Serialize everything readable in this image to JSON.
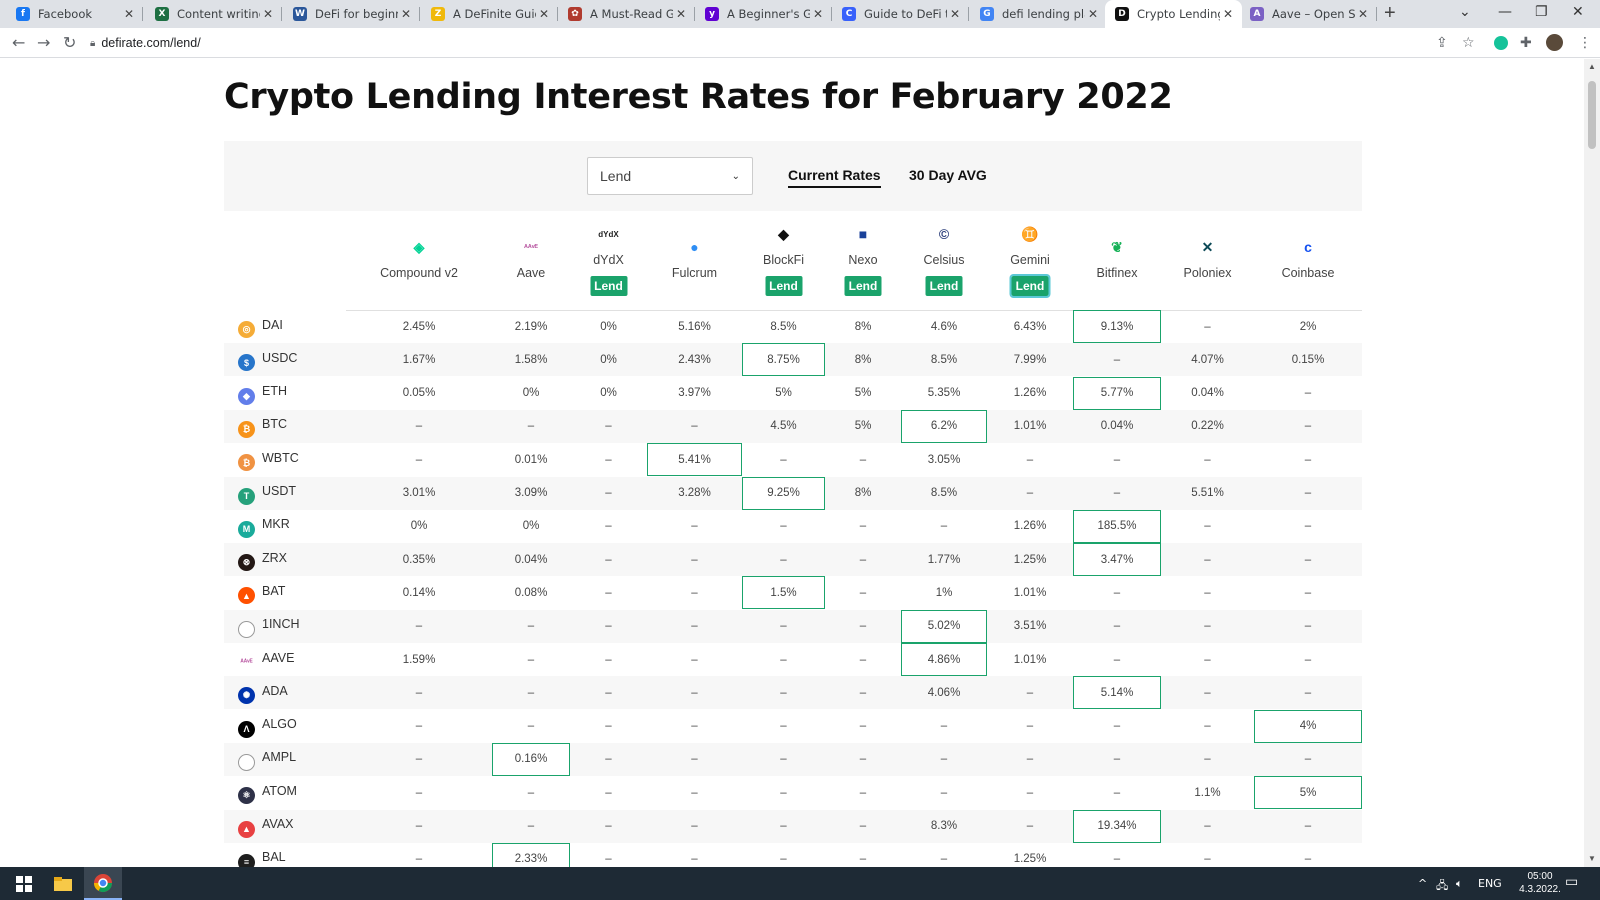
{
  "browser": {
    "tabs": [
      {
        "title": "Facebook",
        "icon": "facebook-icon",
        "color": "#1877f2",
        "glyph": "f"
      },
      {
        "title": "Content writing wi",
        "icon": "excel-icon",
        "color": "#1d6f42",
        "glyph": "X"
      },
      {
        "title": "DeFi for beginners",
        "icon": "word-icon",
        "color": "#2b579a",
        "glyph": "W"
      },
      {
        "title": "A DeFinite Guide t",
        "icon": "binance-icon",
        "color": "#f0b90b",
        "glyph": "Z"
      },
      {
        "title": "A Must-Read Guid",
        "icon": "community-icon",
        "color": "#b03a2e",
        "glyph": "✿"
      },
      {
        "title": "A Beginner's Guide",
        "icon": "yahoo-icon",
        "color": "#6001d2",
        "glyph": "y"
      },
      {
        "title": "Guide to DeFi toke",
        "icon": "coinmarketcap-icon",
        "color": "#3861fb",
        "glyph": "C"
      },
      {
        "title": "defi lending platfo",
        "icon": "google-icon",
        "color": "#4285f4",
        "glyph": "G"
      },
      {
        "title": "Crypto Lending Ra",
        "icon": "defirate-icon",
        "color": "#111111",
        "glyph": "D"
      },
      {
        "title": "Aave – Open Sourc",
        "icon": "aave-icon",
        "color": "#7b61c4",
        "glyph": "A"
      }
    ],
    "url": "defirate.com/lend/"
  },
  "page": {
    "title": "Crypto Lending Interest Rates for February 2022",
    "select_value": "Lend",
    "rate_tabs": [
      "Current Rates",
      "30 Day AVG"
    ],
    "lend_label": "Lend"
  },
  "providers": [
    {
      "name": "Compound v2",
      "icon": "compound-icon",
      "color": "#00d395",
      "glyph": "◈",
      "lend": false
    },
    {
      "name": "Aave",
      "icon": "aave-logo-icon",
      "color": "#b6509e",
      "glyph": "ᴬᴬᵛᴱ",
      "lend": false
    },
    {
      "name": "dYdX",
      "icon": "dydx-icon",
      "color": "#222222",
      "glyph": "dYdX",
      "lend": true
    },
    {
      "name": "Fulcrum",
      "icon": "fulcrum-icon",
      "color": "#2f8ef4",
      "glyph": "●",
      "lend": false
    },
    {
      "name": "BlockFi",
      "icon": "blockfi-icon",
      "color": "#111111",
      "glyph": "◆",
      "lend": true
    },
    {
      "name": "Nexo",
      "icon": "nexo-icon",
      "color": "#1a4199",
      "glyph": "■",
      "lend": true
    },
    {
      "name": "Celsius",
      "icon": "celsius-icon",
      "color": "#2c3e7a",
      "glyph": "©",
      "lend": true
    },
    {
      "name": "Gemini",
      "icon": "gemini-icon",
      "color": "#00dcfa",
      "glyph": "♊",
      "lend": true
    },
    {
      "name": "Bitfinex",
      "icon": "bitfinex-icon",
      "color": "#16b157",
      "glyph": "❦",
      "lend": false
    },
    {
      "name": "Poloniex",
      "icon": "poloniex-icon",
      "color": "#0d4a57",
      "glyph": "✕",
      "lend": false
    },
    {
      "name": "Coinbase",
      "icon": "coinbase-icon",
      "color": "#1652f0",
      "glyph": "c",
      "lend": false
    }
  ],
  "rows": [
    {
      "asset": "DAI",
      "icon": "dai-icon",
      "color": "#f5ac37",
      "glyph": "◎",
      "rates": [
        "2.45%",
        "2.19%",
        "0%",
        "5.16%",
        "8.5%",
        "8%",
        "4.6%",
        "6.43%",
        "9.13%",
        "–",
        "2%"
      ],
      "best": 8
    },
    {
      "asset": "USDC",
      "icon": "usdc-icon",
      "color": "#2775ca",
      "glyph": "$",
      "rates": [
        "1.67%",
        "1.58%",
        "0%",
        "2.43%",
        "8.75%",
        "8%",
        "8.5%",
        "7.99%",
        "–",
        "4.07%",
        "0.15%"
      ],
      "best": 4
    },
    {
      "asset": "ETH",
      "icon": "eth-icon",
      "color": "#627eea",
      "glyph": "◆",
      "rates": [
        "0.05%",
        "0%",
        "0%",
        "3.97%",
        "5%",
        "5%",
        "5.35%",
        "1.26%",
        "5.77%",
        "0.04%",
        "–"
      ],
      "best": 8
    },
    {
      "asset": "BTC",
      "icon": "btc-icon",
      "color": "#f7931a",
      "glyph": "₿",
      "rates": [
        "–",
        "–",
        "–",
        "–",
        "4.5%",
        "5%",
        "6.2%",
        "1.01%",
        "0.04%",
        "0.22%",
        "–"
      ],
      "best": 6
    },
    {
      "asset": "WBTC",
      "icon": "wbtc-icon",
      "color": "#f09242",
      "glyph": "₿",
      "rates": [
        "–",
        "0.01%",
        "–",
        "5.41%",
        "–",
        "–",
        "3.05%",
        "–",
        "–",
        "–",
        "–"
      ],
      "best": 3
    },
    {
      "asset": "USDT",
      "icon": "usdt-icon",
      "color": "#26a17b",
      "glyph": "T",
      "rates": [
        "3.01%",
        "3.09%",
        "–",
        "3.28%",
        "9.25%",
        "8%",
        "8.5%",
        "–",
        "–",
        "5.51%",
        "–"
      ],
      "best": 4
    },
    {
      "asset": "MKR",
      "icon": "mkr-icon",
      "color": "#1aab9b",
      "glyph": "M",
      "rates": [
        "0%",
        "0%",
        "–",
        "–",
        "–",
        "–",
        "–",
        "1.26%",
        "185.5%",
        "–",
        "–"
      ],
      "best": 8
    },
    {
      "asset": "ZRX",
      "icon": "zrx-icon",
      "color": "#231815",
      "glyph": "⊗",
      "rates": [
        "0.35%",
        "0.04%",
        "–",
        "–",
        "–",
        "–",
        "1.77%",
        "1.25%",
        "3.47%",
        "–",
        "–"
      ],
      "best": 8
    },
    {
      "asset": "BAT",
      "icon": "bat-icon",
      "color": "#ff5000",
      "glyph": "▲",
      "rates": [
        "0.14%",
        "0.08%",
        "–",
        "–",
        "1.5%",
        "–",
        "1%",
        "1.01%",
        "–",
        "–",
        "–"
      ],
      "best": 4
    },
    {
      "asset": "1INCH",
      "icon": "1inch-icon",
      "color": "#ffffff",
      "glyph": "",
      "rates": [
        "–",
        "–",
        "–",
        "–",
        "–",
        "–",
        "5.02%",
        "3.51%",
        "–",
        "–",
        "–"
      ],
      "best": 6
    },
    {
      "asset": "AAVE",
      "icon": "aave-token-icon",
      "color": "#b6509e",
      "glyph": "ᴬᴬᵛᴱ",
      "rates": [
        "1.59%",
        "–",
        "–",
        "–",
        "–",
        "–",
        "4.86%",
        "1.01%",
        "–",
        "–",
        "–"
      ],
      "best": 6
    },
    {
      "asset": "ADA",
      "icon": "ada-icon",
      "color": "#0033ad",
      "glyph": "✺",
      "rates": [
        "–",
        "–",
        "–",
        "–",
        "–",
        "–",
        "4.06%",
        "–",
        "5.14%",
        "–",
        "–"
      ],
      "best": 8
    },
    {
      "asset": "ALGO",
      "icon": "algo-icon",
      "color": "#000000",
      "glyph": "Ʌ",
      "rates": [
        "–",
        "–",
        "–",
        "–",
        "–",
        "–",
        "–",
        "–",
        "–",
        "–",
        "4%"
      ],
      "best": 10
    },
    {
      "asset": "AMPL",
      "icon": "ampl-icon",
      "color": "#ffffff",
      "glyph": "",
      "rates": [
        "–",
        "0.16%",
        "–",
        "–",
        "–",
        "–",
        "–",
        "–",
        "–",
        "–",
        "–"
      ],
      "best": 1
    },
    {
      "asset": "ATOM",
      "icon": "atom-icon",
      "color": "#2e3148",
      "glyph": "⚛",
      "rates": [
        "–",
        "–",
        "–",
        "–",
        "–",
        "–",
        "–",
        "–",
        "–",
        "1.1%",
        "5%"
      ],
      "best": 10
    },
    {
      "asset": "AVAX",
      "icon": "avax-icon",
      "color": "#e84142",
      "glyph": "▲",
      "rates": [
        "–",
        "–",
        "–",
        "–",
        "–",
        "–",
        "8.3%",
        "–",
        "19.34%",
        "–",
        "–"
      ],
      "best": 8
    },
    {
      "asset": "BAL",
      "icon": "bal-icon",
      "color": "#1e1e1e",
      "glyph": "≡",
      "rates": [
        "–",
        "2.33%",
        "–",
        "–",
        "–",
        "–",
        "–",
        "1.25%",
        "–",
        "–",
        "–"
      ],
      "best": 1
    }
  ],
  "taskbar": {
    "lang": "ENG",
    "time": "05:00",
    "date": "4.3.2022."
  }
}
